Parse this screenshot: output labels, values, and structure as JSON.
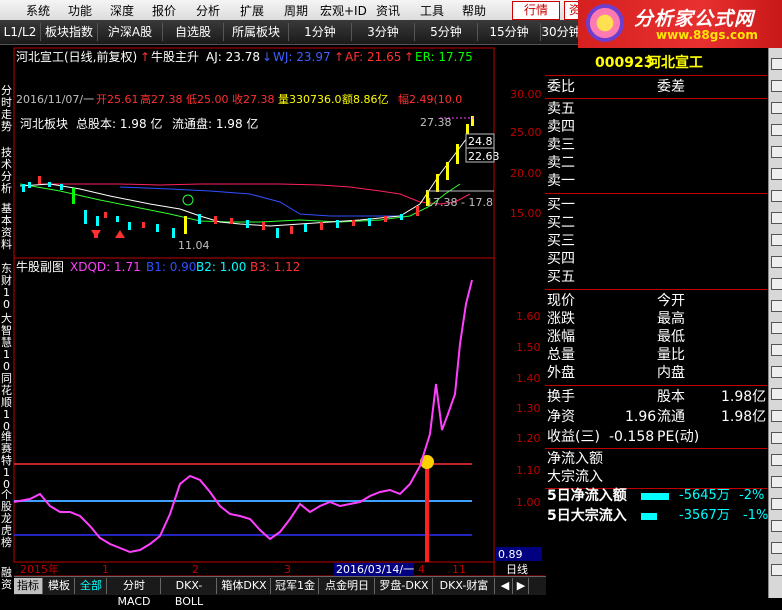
{
  "menu": {
    "items": [
      "系统",
      "功能",
      "深度",
      "报价",
      "分析",
      "扩展",
      "周期",
      "宏观+ID",
      "资讯",
      "工具",
      "帮助"
    ],
    "quick": [
      "行情",
      "资"
    ]
  },
  "logo": {
    "title": "分析家公式网",
    "url": "www.88gs.com"
  },
  "toolbar": {
    "items": [
      "L1/L2",
      "板块指数",
      "沪深A股",
      "自选股",
      "所属板块",
      "1分钟",
      "3分钟",
      "5分钟",
      "15分钟",
      "30分钟"
    ]
  },
  "left_nav": [
    "分时走势",
    "技术分析",
    "基本资料",
    "东财10",
    "大智慧10",
    "同花顺10",
    "维赛特10",
    "个股龙虎榜",
    "融资"
  ],
  "chart_header": {
    "name": "河北宣工(日线,前复权)",
    "indicator": "牛股主升",
    "aj": "AJ: 23.78",
    "wj": "WJ: 23.97",
    "af": "AF: 21.65",
    "er": "ER: 17.75"
  },
  "price_info": {
    "date": "2016/11/07/一",
    "open": "开25.61",
    "high": "高27.38",
    "low": "低25.00",
    "close": "收27.38",
    "vol": "量330736.0",
    "amt": "额8.86亿",
    "amp": "幅2.49(10.0"
  },
  "stock_info": {
    "sector": "河北板块",
    "total": "总股本: 1.98 亿",
    "float": "流通盘: 1.98 亿"
  },
  "price_axis": [
    "30.00",
    "25.00",
    "20.00",
    "15.00"
  ],
  "price_labels": {
    "high_tag": "27.38",
    "l1": "24.8",
    "l2": "22.63",
    "range": "17.38 - 17.8",
    "low_tag": "11.04"
  },
  "sub_header": {
    "name": "牛股副图",
    "xdqd": "XDQD: 1.71",
    "b1": "B1: 0.90",
    "b2": "B2: 1.00",
    "b3": "B3: 1.12"
  },
  "sub_axis": [
    "1.60",
    "1.50",
    "1.40",
    "1.30",
    "1.20",
    "1.10",
    "1.00"
  ],
  "sub_current": "0.89",
  "x_axis": {
    "start": "2015年",
    "m1": "1",
    "m2": "2",
    "m3": "3",
    "date_box": "2016/03/14/一",
    "m4": "4",
    "m5": "11",
    "period": "日线"
  },
  "bottom_tabs": [
    "指标",
    "模板",
    "全部",
    "分时MACD",
    "DKX-BOLL",
    "箱体DKX",
    "冠军1金",
    "点金明日",
    "罗盘-DKX",
    "DKX-财富"
  ],
  "panel": {
    "code": "000923",
    "name": "河北宣工",
    "weibi": "委比",
    "weicha": "委差",
    "sell": [
      "卖五",
      "卖四",
      "卖三",
      "卖二",
      "卖一"
    ],
    "buy": [
      "买一",
      "买二",
      "买三",
      "买四",
      "买五"
    ],
    "quote_left": [
      "现价",
      "涨跌",
      "涨幅",
      "总量",
      "外盘"
    ],
    "quote_right": [
      "今开",
      "最高",
      "最低",
      "量比",
      "内盘"
    ],
    "turnover": "换手",
    "equity_label": "股本",
    "equity_value": "1.98亿",
    "netasset_label": "净资",
    "netasset_value": "1.96",
    "float_label": "流通",
    "float_value": "1.98亿",
    "eps_label": "收益(三)",
    "eps_value": "-0.158",
    "pe_label": "PE(动)",
    "flow1": "净流入额",
    "flow2": "大宗流入",
    "flow5_1_label": "5日净流入额",
    "flow5_1_value": "-5645万",
    "flow5_1_pct": "-2%",
    "flow5_2_label": "5日大宗流入",
    "flow5_2_value": "-3567万",
    "flow5_2_pct": "-1%"
  },
  "colors": {
    "up": "#ff3030",
    "down": "#00ffff",
    "axis": "#c00000",
    "magenta": "#ff40ff",
    "yellow": "#ffff00"
  }
}
